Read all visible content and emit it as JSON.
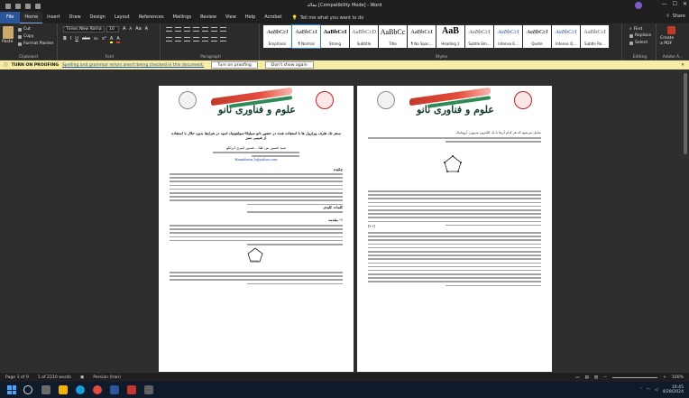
{
  "window": {
    "title": "مقاله [Compatibility Mode] - Word",
    "minimize": "—",
    "maximize": "☐",
    "close": "✕"
  },
  "tabs": [
    "File",
    "Home",
    "Insert",
    "Draw",
    "Design",
    "Layout",
    "References",
    "Mailings",
    "Review",
    "View",
    "Help",
    "Acrobat"
  ],
  "tell_me": "Tell me what you want to do",
  "share": "Share",
  "clipboard": {
    "paste": "Paste",
    "cut": "Cut",
    "copy": "Copy",
    "format_painter": "Format Painter",
    "label": "Clipboard"
  },
  "font": {
    "name": "Times New Roma",
    "size": "10",
    "label": "Font",
    "bold": "B",
    "italic": "I",
    "underline": "U",
    "strike": "abc",
    "sub": "x₂",
    "sup": "x²",
    "color": "A",
    "highlight": "A",
    "grow": "A",
    "shrink": "A",
    "case": "Aa",
    "clear": "A"
  },
  "paragraph": {
    "label": "Paragraph"
  },
  "styles": {
    "label": "Styles",
    "items": [
      {
        "preview": "AaBbCcI",
        "name": "Emphasis"
      },
      {
        "preview": "AaBbCcI",
        "name": "¶ Normal"
      },
      {
        "preview": "AaBbCcI",
        "name": "Strong"
      },
      {
        "preview": "AaBbCcD",
        "name": "Subtitle"
      },
      {
        "preview": "AaBbCc",
        "name": "Title"
      },
      {
        "preview": "AaBbCcI",
        "name": "¶ No Spac..."
      },
      {
        "preview": "AaB",
        "name": "Heading 1"
      },
      {
        "preview": "AaBbCcI",
        "name": "Subtle Em..."
      },
      {
        "preview": "AaBbCcI",
        "name": "Intense E..."
      },
      {
        "preview": "AaBbCcI",
        "name": "Quote"
      },
      {
        "preview": "AaBbCcI",
        "name": "Intense Q..."
      },
      {
        "preview": "AaBbCcI",
        "name": "Subtle Re..."
      }
    ]
  },
  "editing": {
    "find": "Find",
    "replace": "Replace",
    "select": "Select",
    "label": "Editing"
  },
  "create": {
    "line1": "Create",
    "line2": "a PDF",
    "label": "Adobe A..."
  },
  "proofing_bar": {
    "prefix": "TURN ON PROOFING",
    "message": "Spelling and grammar errors aren't being checked in this document.",
    "turn_on": "Turn on proofing",
    "dont_show": "Don't show again"
  },
  "pages": {
    "brand": "علوم و فناوری نانو",
    "left_title": "سنتز تک ظرف پیرازول ها با استفاده شده در حضور نانو سیلیکا-سولفونیک اسید در شرایط بدون حلال با استفاده از شیمی سبز",
    "left_authors": "سید حسین بنی طبا – حسین امیری ایرانلو",
    "left_email": "Hamidreza_h@yahoo.com",
    "left_abstract_heading": "چکیده",
    "left_keywords_heading": "کلمات کلیدی",
    "left_intro_heading": "۱- مقدمه",
    "right_intro": "شامل می‌شود که هر کدام آن‌ها با یک الکترون نیتروژن آروماتیک",
    "right_ref": "[۴-۶]"
  },
  "status": {
    "page": "Page 1 of 9",
    "words": "1 of 2210 words",
    "language": "Persian (Iran)",
    "zoom": "100%"
  },
  "taskbar": {
    "time": "10:45",
    "date": "4/28/2024"
  },
  "colors": {
    "accent": "#2b579a",
    "proof_bar": "#f6eca4",
    "brand_green": "#0f3b2b",
    "brand_red": "#c0392b"
  }
}
